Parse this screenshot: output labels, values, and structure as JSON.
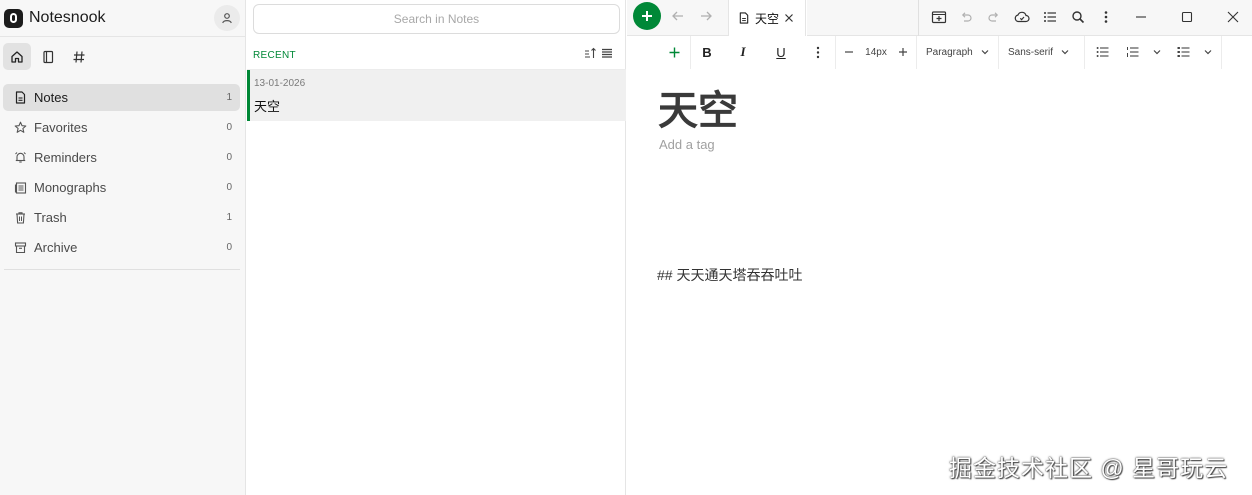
{
  "app": {
    "name": "Notesnook"
  },
  "sidebar": {
    "top_icons": [
      {
        "name": "home-icon",
        "active": true
      },
      {
        "name": "notebook-icon",
        "active": false
      },
      {
        "name": "hash-icon",
        "active": false
      }
    ],
    "items": [
      {
        "label": "Notes",
        "count": "1",
        "icon": "note-icon",
        "active": true
      },
      {
        "label": "Favorites",
        "count": "0",
        "icon": "star-icon",
        "active": false
      },
      {
        "label": "Reminders",
        "count": "0",
        "icon": "bell-icon",
        "active": false
      },
      {
        "label": "Monographs",
        "count": "0",
        "icon": "monograph-icon",
        "active": false
      },
      {
        "label": "Trash",
        "count": "1",
        "icon": "trash-icon",
        "active": false
      },
      {
        "label": "Archive",
        "count": "0",
        "icon": "archive-icon",
        "active": false
      }
    ]
  },
  "notes_list": {
    "search_placeholder": "Search in Notes",
    "group_label": "RECENT",
    "notes": [
      {
        "date": "13-01-2026",
        "title": "天空"
      }
    ]
  },
  "tabs": [
    {
      "label": "天空"
    }
  ],
  "toolbar": {
    "font_size": "14px",
    "block_type": "Paragraph",
    "font_family": "Sans-serif"
  },
  "editor": {
    "title": "天空",
    "tag_placeholder": "Add a tag",
    "body": "## 天天通天塔吞吞吐吐"
  },
  "watermark": "掘金技术社区 @ 星哥玩云",
  "colors": {
    "accent": "#008837"
  }
}
